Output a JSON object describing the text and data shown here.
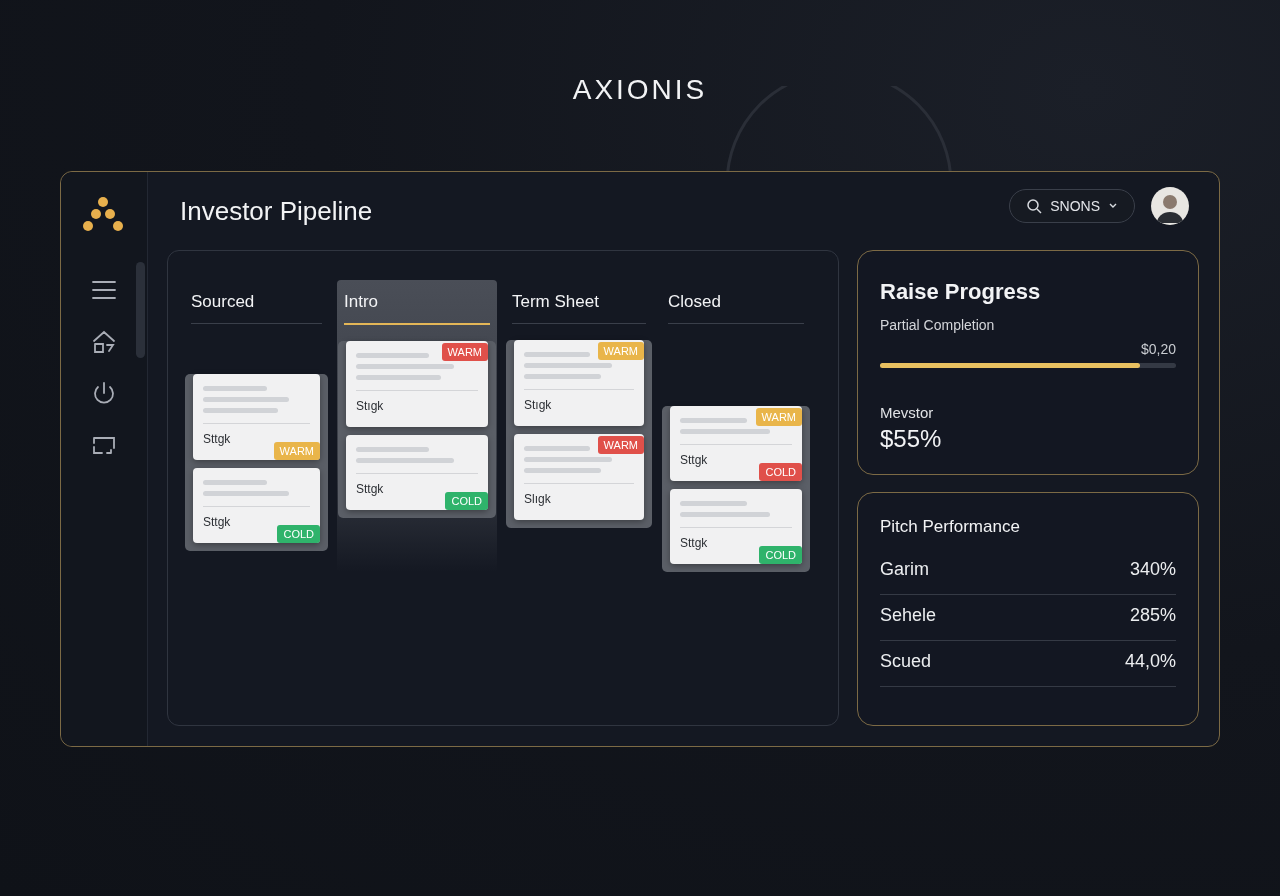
{
  "brand": "AXIONIS",
  "sidebar": {
    "items": [
      {
        "kind": "menu",
        "selected": false
      },
      {
        "kind": "home",
        "selected": false
      },
      {
        "kind": "power",
        "selected": false
      },
      {
        "kind": "screen",
        "selected": false
      }
    ]
  },
  "header": {
    "title": "Investor Pipeline",
    "search": {
      "label": "SNONS"
    }
  },
  "board": {
    "columns": [
      {
        "title": "Sourced",
        "selected": false,
        "cards": [
          {
            "label": "Sttgk",
            "tags": [
              {
                "text": "WARM",
                "color": "#e9b54a"
              }
            ]
          },
          {
            "label": "Sttgk",
            "tags": [
              {
                "text": "COLD",
                "color": "#2fb36b"
              }
            ]
          }
        ]
      },
      {
        "title": "Intro",
        "selected": true,
        "cards": [
          {
            "label": "Stıgk",
            "tags": [
              {
                "text": "WARM",
                "color": "#e0504a"
              }
            ]
          },
          {
            "label": "Sttgk",
            "tags": [
              {
                "text": "COLD",
                "color": "#2fb36b"
              }
            ]
          }
        ]
      },
      {
        "title": "Term Sheet",
        "selected": false,
        "cards": [
          {
            "label": "Stıgk",
            "tags": [
              {
                "text": "WARM",
                "color": "#e9b54a"
              }
            ]
          },
          {
            "label": "Slıgk",
            "tags": [
              {
                "text": "WARM",
                "color": "#e0504a"
              }
            ]
          }
        ]
      },
      {
        "title": "Closed",
        "selected": false,
        "cards": [
          {
            "label": "Sttgk",
            "tags": [
              {
                "text": "WARM",
                "color": "#e9b54a"
              },
              {
                "text": "COLD",
                "color": "#e0504a"
              }
            ]
          },
          {
            "label": "Sttgk",
            "tags": [
              {
                "text": "COLD",
                "color": "#2fb36b"
              }
            ]
          }
        ]
      }
    ]
  },
  "raise_progress": {
    "title": "Raise Progress",
    "subtitle": "Partial Completion",
    "reading": "$0,20",
    "level": 0.88,
    "metric_label": "Mevstor",
    "metric_value": "$55%"
  },
  "pitch_performance": {
    "title": "Pitch Performance",
    "rows": [
      {
        "name": "Garim",
        "value": "340%"
      },
      {
        "name": "Sehele",
        "value": "285%"
      },
      {
        "name": "Scued",
        "value": "44,0%"
      }
    ]
  }
}
